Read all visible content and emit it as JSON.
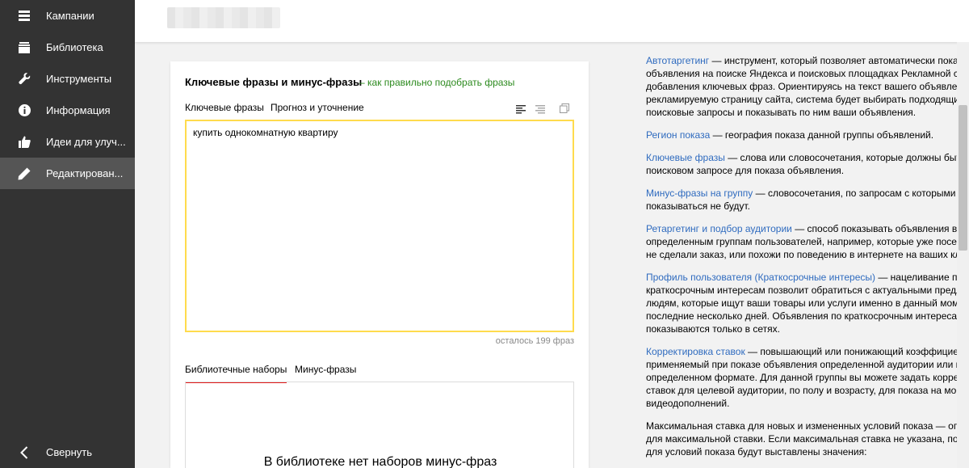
{
  "sidebar": {
    "items": [
      {
        "label": "Кампании",
        "icon": "list-icon"
      },
      {
        "label": "Библиотека",
        "icon": "library-icon"
      },
      {
        "label": "Инструменты",
        "icon": "wrench-icon"
      },
      {
        "label": "Информация",
        "icon": "info-icon"
      },
      {
        "label": "Идеи для улуч...",
        "icon": "thumbs-up-icon"
      },
      {
        "label": "Редактирован...",
        "icon": "pencil-icon",
        "active": true
      }
    ],
    "collapse_label": "Свернуть"
  },
  "card": {
    "title": "Ключевые фразы и минус-фразы",
    "help_link": "– как правильно подобрать фразы",
    "tabs": [
      {
        "label": "Ключевые фразы",
        "active": true
      },
      {
        "label": "Прогноз и уточнение",
        "active": false
      }
    ],
    "keywords_value": "купить однокомнатную квартиру",
    "counter": "осталось 199 фраз",
    "lower_tabs": [
      {
        "label": "Библиотечные наборы",
        "active": true
      },
      {
        "label": "Минус-фразы",
        "active": false
      }
    ],
    "library_empty_text": "В библиотеке нет наборов минус-фраз"
  },
  "help": {
    "autotargeting": {
      "term": "Автотаргетинг",
      "text": " — инструмент, который позволяет автоматически показ объявления на поиске Яндекса и поисковых площадках Рекламной сети добавления ключевых фраз. Ориентируясь на текст вашего объявления рекламируемую страницу сайта, система будет выбирать подходящие поисковые запросы и показывать по ним ваши объявления."
    },
    "region": {
      "term": "Регион показа",
      "text": " — география показа данной группы объявлений."
    },
    "keywords": {
      "term": "Ключевые фразы",
      "text": " — слова или словосочетания, которые должны быть в поисковом запросе для показа объявления."
    },
    "negative": {
      "term": "Минус-фразы на группу",
      "text": " — словосочетания, по запросам с которыми об показываться не будут."
    },
    "retargeting": {
      "term": "Ретаргетинг и подбор аудитории",
      "text": " — способ показывать объявления в се определенным группам пользователей, например, которые уже посеща но не сделали заказ, или похожи по поведению в интернете на ваших кл"
    },
    "profile": {
      "term": "Профиль пользователя (Краткосрочные интересы)",
      "text": " — нацеливание по краткосрочным интересам позволит обратиться с актуальными предло к людям, которые ищут ваши товары или услуги именно в данный моме последние несколько дней. Объявления по краткосрочным интересам показываются только в сетях."
    },
    "bids": {
      "term": "Корректировка ставок",
      "text": " — повышающий или понижающий коэффициент применяемый при показе объявления определенной аудитории или в определенном формате. Для данной группы вы можете задать коррект ставок для целевой аудитории, по полу и возрасту, для показа на мобил видеодополнений."
    },
    "maxbid": "Максимальная ставка для новых и измененных условий показа — огран для максимальной ставки. Если максимальная ставка не указана, по ум для условий показа будут выставлены значения:"
  },
  "colors": {
    "sidebar_bg": "#333333",
    "accent_red": "#e21a1a",
    "input_border": "#ffdb4d",
    "link_green": "#2c8a1e",
    "link_blue": "#2f6bbf"
  }
}
